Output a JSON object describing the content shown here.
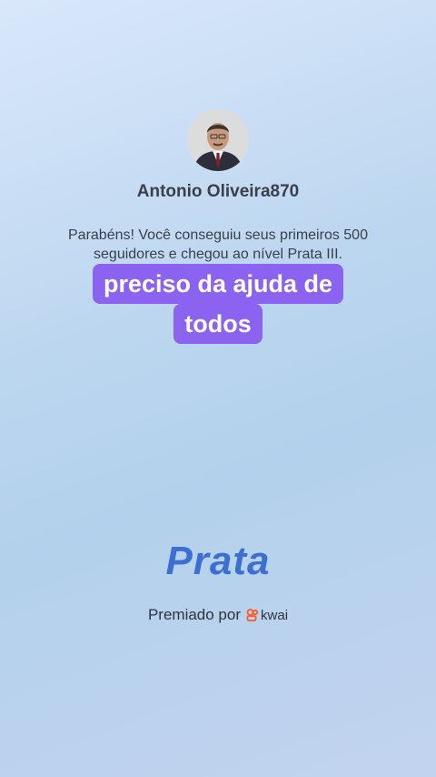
{
  "profile": {
    "username": "Antonio Oliveira870"
  },
  "message": "Parabéns! Você conseguiu seus primeiros 500 seguidores e chegou ao nível Prata III.",
  "caption": {
    "line1": "preciso da ajuda de",
    "line2": "todos"
  },
  "level": {
    "name": "Prata"
  },
  "footer": {
    "awarded_by": "Premiado por",
    "brand": "kwai",
    "brand_icon": "kwai-logo-icon",
    "brand_color": "#ff5a1f"
  },
  "colors": {
    "caption_bg": "#8b63f0",
    "level_text": "#3d6fd0"
  }
}
